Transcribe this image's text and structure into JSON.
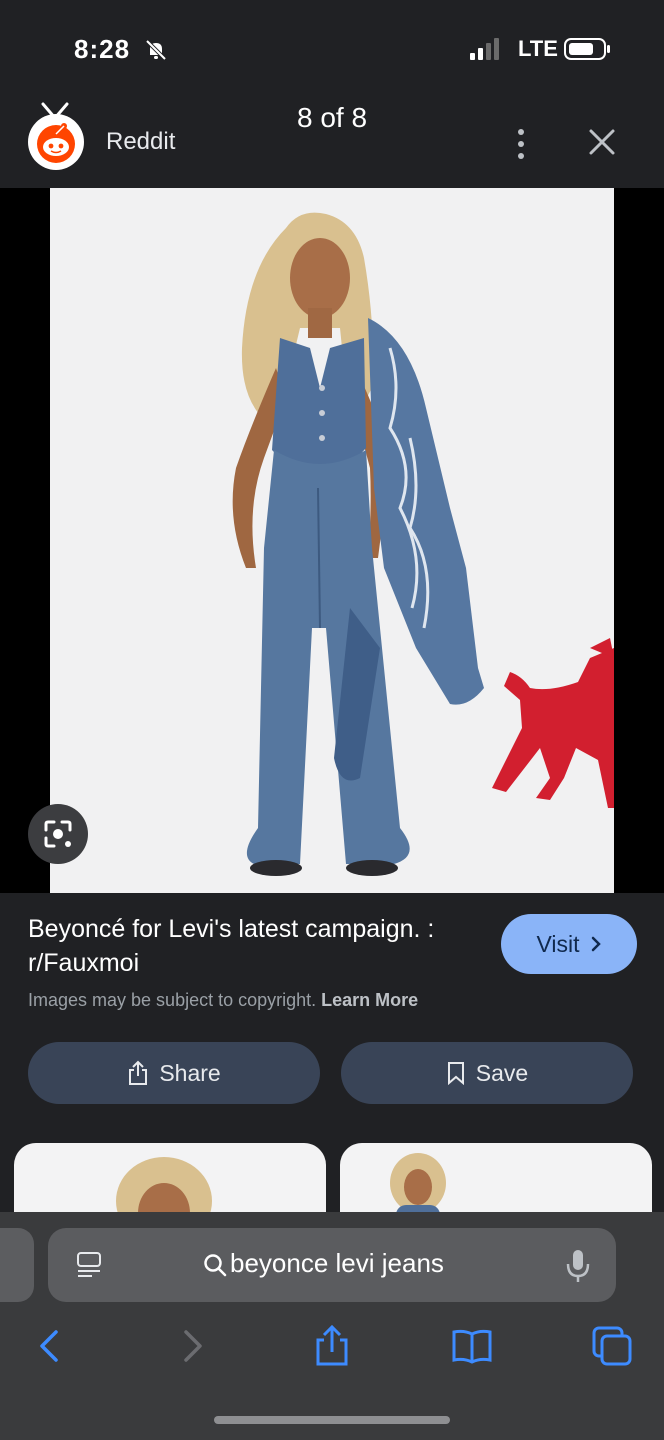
{
  "status_bar": {
    "time": "8:28",
    "network": "LTE",
    "icons": [
      "bell-off-icon",
      "signal-icon",
      "battery-icon"
    ]
  },
  "viewer": {
    "site_name": "Reddit",
    "counter": "8 of 8",
    "icons": [
      "reddit-logo-icon",
      "more-vert-icon",
      "close-icon"
    ]
  },
  "result": {
    "title": "Beyoncé for Levi's latest campaign. : r/Fauxmoi",
    "visit_label": "Visit",
    "copyright_text": "Images may be subject to copyright.",
    "learn_more": "Learn More"
  },
  "actions": {
    "share_label": "Share",
    "save_label": "Save"
  },
  "browser": {
    "search_query": "beyonce levi jeans",
    "toolbar_icons": [
      "back-icon",
      "forward-icon",
      "share-icon",
      "bookmarks-icon",
      "tabs-icon"
    ]
  },
  "colors": {
    "background": "#202124",
    "accent": "#8ab4f8",
    "button": "#394457",
    "reddit_orange": "#ff4500",
    "denim": "#4f6f9a",
    "horse_red": "#d21f2f"
  }
}
